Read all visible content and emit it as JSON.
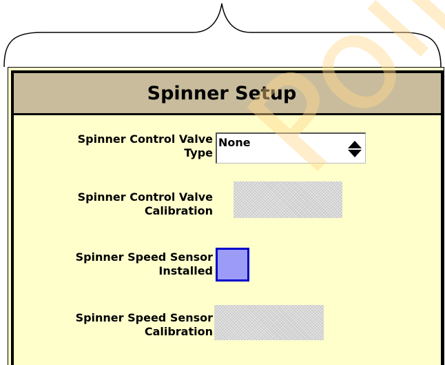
{
  "window": {
    "title": "Spinner Setup"
  },
  "fields": {
    "valve_type": {
      "label_line1": "Spinner Control Valve",
      "label_line2": "Type",
      "value": "None"
    },
    "valve_calibration": {
      "label_line1": "Spinner Control Valve",
      "label_line2": "Calibration"
    },
    "speed_sensor_installed": {
      "label_line1": "Spinner Speed Sensor",
      "label_line2": "Installed",
      "checked": false
    },
    "speed_sensor_calibration": {
      "label_line1": "Spinner Speed Sensor",
      "label_line2": "Calibration"
    }
  },
  "watermark": {
    "text": "Point"
  },
  "colors": {
    "panel_background": "#ffffcc",
    "title_background": "#c8bc9c",
    "checkbox_fill": "#9c9cf8",
    "checkbox_border": "#0000cc"
  },
  "icons": {
    "select_arrows": "up-down-arrows-icon",
    "brace": "curly-brace-icon"
  }
}
